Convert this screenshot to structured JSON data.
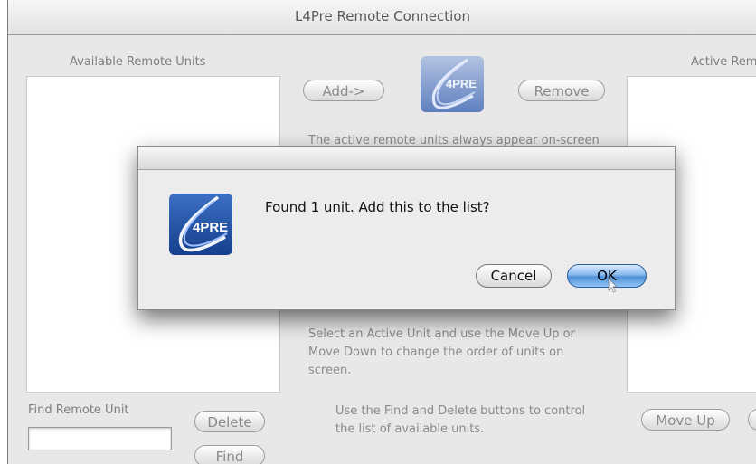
{
  "window": {
    "title": "L4Pre Remote Connection"
  },
  "available": {
    "label": "Available Remote Units"
  },
  "active": {
    "label": "Active Rem"
  },
  "buttons": {
    "add": "Add->",
    "remove": "Remove",
    "delete": "Delete",
    "find": "Find",
    "move_up": "Move Up"
  },
  "find": {
    "label": "Find Remote Unit",
    "value": ""
  },
  "help": {
    "top": "The active remote units always appear on-screen",
    "order": "Select an Active Unit and use the Move Up or Move Down to change the order of units on screen.",
    "find_delete": "Use the Find and Delete buttons to control the list of available units."
  },
  "logo": {
    "text": "4PRE",
    "icon": "4pre-logo-icon"
  },
  "dialog": {
    "message": "Found 1 unit. Add this to the list?",
    "cancel": "Cancel",
    "ok": "OK"
  },
  "colors": {
    "logo_blue": "#1f4fa2",
    "ok_blue": "#4f8fd6",
    "window_bg": "#e8e8e8"
  }
}
